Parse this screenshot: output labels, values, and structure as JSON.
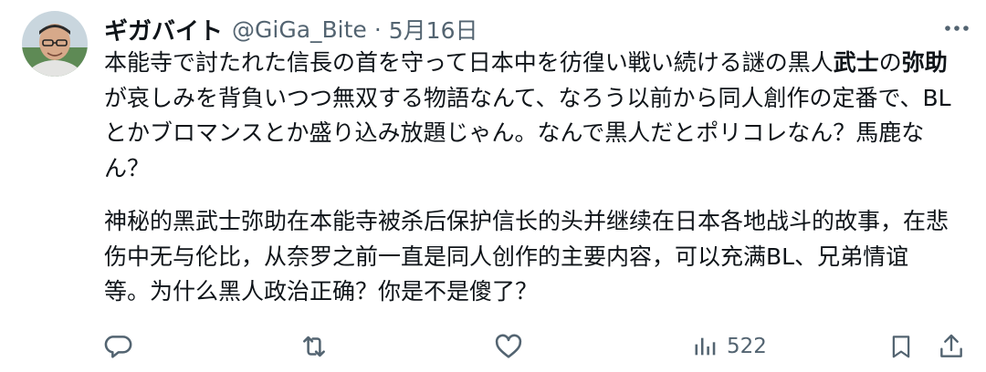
{
  "tweet": {
    "display_name": "ギガバイト",
    "handle": "@GiGa_Bite",
    "separator": "·",
    "date": "5月16日",
    "body_ja_part1": "本能寺で討たれた信長の首を守って日本中を彷徨い戦い続ける謎の黒人",
    "body_ja_bold1": "武士",
    "body_ja_part2": "の",
    "body_ja_bold2": "弥助",
    "body_ja_part3": "が哀しみを背負いつつ無双する物語なんて、なろう以前から同人創作の定番で、BLとかブロマンスとか盛り込み放題じゃん。なんで黒人だとポリコレなん？馬鹿なん？",
    "body_zh": "神秘的黑武士弥助在本能寺被杀后保护信长的头并继续在日本各地战斗的故事，在悲伤中无与伦比，从奈罗之前一直是同人创作的主要内容，可以充满BL、兄弟情谊等。为什么黑人政治正确？你是不是傻了？"
  },
  "actions": {
    "reply_icon": "reply-icon",
    "retweet_icon": "retweet-icon",
    "like_icon": "heart-icon",
    "views_icon": "views-chart-icon",
    "views_count": "522",
    "bookmark_icon": "bookmark-icon",
    "share_icon": "share-icon",
    "more_icon": "more-dots-icon"
  },
  "colors": {
    "text": "#0f1419",
    "secondary": "#536471"
  }
}
